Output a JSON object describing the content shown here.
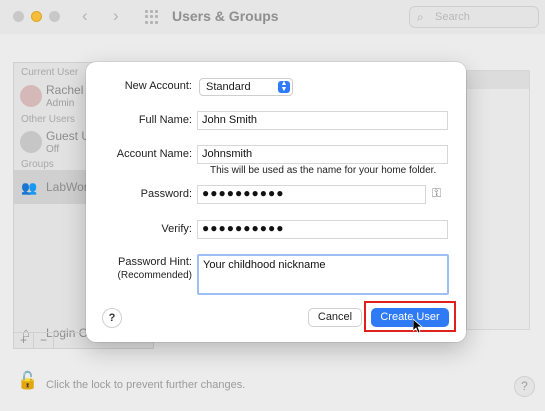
{
  "window": {
    "title": "Users & Groups",
    "search_placeholder": "Search"
  },
  "sidebar": {
    "current_user_label": "Current User",
    "current_user_name": "Rachel M",
    "current_user_role": "Admin",
    "other_users_label": "Other Users",
    "guest_name": "Guest U",
    "guest_status": "Off",
    "groups_label": "Groups",
    "group_name": "LabWork",
    "login_options": "Login Op",
    "add_symbol": "+",
    "remove_symbol": "−"
  },
  "footer": {
    "lock_text": "Click the lock to prevent further changes.",
    "help_symbol": "?"
  },
  "dialog": {
    "new_account_label": "New Account:",
    "new_account_value": "Standard",
    "full_name_label": "Full Name:",
    "full_name_value": "John Smith",
    "account_name_label": "Account Name:",
    "account_name_value": "Johnsmith",
    "account_name_help": "This will be used as the name for your home folder.",
    "password_label": "Password:",
    "password_value": "●●●●●●●●●●",
    "verify_label": "Verify:",
    "verify_value": "●●●●●●●●●●",
    "hint_label": "Password Hint:",
    "hint_sublabel": "(Recommended)",
    "hint_value": "Your childhood nickname",
    "help_symbol": "?",
    "cancel_label": "Cancel",
    "create_label": "Create User"
  },
  "icons": {
    "search": "magnifier-icon",
    "key": "key-icon",
    "lock": "lock-icon",
    "popup": "chevron-updown-icon"
  },
  "colors": {
    "accent": "#2f7bf5",
    "highlight": "#e0201b"
  }
}
